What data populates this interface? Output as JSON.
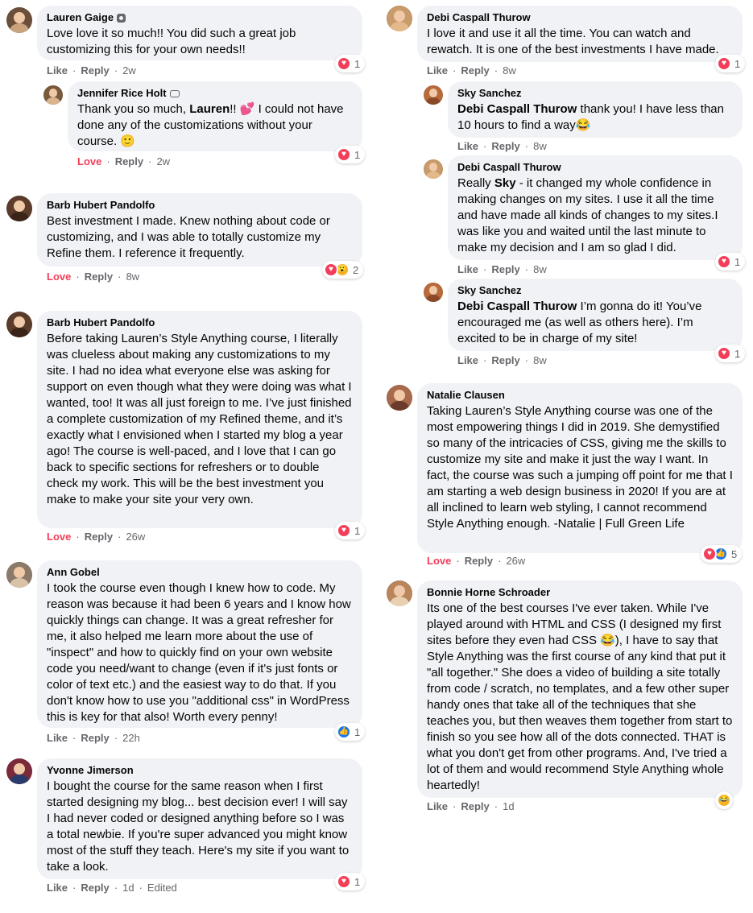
{
  "left_column": [
    {
      "name": "Lauren Gaige",
      "name_icon": "shield-icon",
      "text_parts": [
        {
          "t": "Love love it so much!! You did such a great job customizing this for your own needs!!"
        }
      ],
      "actions": {
        "first": "Like",
        "second": "Reply",
        "time": "2w"
      },
      "reactions": {
        "icons": [
          "love"
        ],
        "count": "1"
      },
      "avatar_colors": [
        "#c9a27e",
        "#6b4f3a"
      ]
    },
    {
      "name": "Jennifer Rice Holt",
      "name_icon": "chat-bubble-icon",
      "text_parts": [
        {
          "t": "Thank you so much, "
        },
        {
          "t": "Lauren",
          "bold": true
        },
        {
          "t": "!! 💕 I could not have done any of the customizations without your course. 🙂"
        }
      ],
      "actions": {
        "first": "Love",
        "second": "Reply",
        "time": "2w"
      },
      "reactions": {
        "icons": [
          "love"
        ],
        "count": "1"
      },
      "avatar_colors": [
        "#d9b48f",
        "#7a5a3c"
      ]
    },
    {
      "name": "Barb Hubert Pandolfo",
      "text_parts": [
        {
          "t": "Best investment I made. Knew nothing about code or customizing, and I was able to totally customize my Refine them. I reference it frequently."
        }
      ],
      "actions": {
        "first": "Love",
        "second": "Reply",
        "time": "8w"
      },
      "reactions": {
        "icons": [
          "love",
          "wow"
        ],
        "count": "2"
      },
      "avatar_colors": [
        "#3a2418",
        "#5b3b2a"
      ]
    },
    {
      "name": "Barb Hubert Pandolfo",
      "text_parts": [
        {
          "t": "Before taking Lauren’s Style Anything course, I literally was clueless about making any customizations to my site. I had no idea what everyone else was asking for support on even though what they were doing was what I wanted, too! It was all just foreign to me. I’ve just finished a complete customization of my Refined theme, and it’s exactly what I envisioned when I started my blog a year ago! The course is well-paced, and I love that I can go back to specific sections for refreshers or to double check my work. This will be the best investment you make to make your site your very own."
        }
      ],
      "actions": {
        "first": "Love",
        "second": "Reply",
        "time": "26w"
      },
      "reactions": {
        "icons": [
          "love"
        ],
        "count": "1"
      },
      "avatar_colors": [
        "#3a2418",
        "#5b3b2a"
      ]
    },
    {
      "name": "Ann Gobel",
      "text_parts": [
        {
          "t": "I took the course even though I knew how to code. My reason was because it had been 6 years and I know how quickly things can change. It was a great refresher for me, it also helped me learn more about the use of \"inspect\" and how to quickly find on your own website code you need/want to change (even if it's just fonts or color of text etc.) and the easiest way to do that. If you don't know how to use you \"additional css\" in WordPress this is key for that also! Worth every penny!"
        }
      ],
      "actions": {
        "first": "Like",
        "second": "Reply",
        "time": "22h"
      },
      "reactions": {
        "icons": [
          "like"
        ],
        "count": "1"
      },
      "avatar_colors": [
        "#d8c2a8",
        "#8b7a6a"
      ]
    },
    {
      "name": "Yvonne Jimerson",
      "text_parts": [
        {
          "t": "I bought the course for the same reason when I first started designing my blog... best decision ever! I will say I had never coded or designed anything before so I was a total newbie. If you're super advanced you might know most of the stuff they teach. Here's my site if you want to take a look."
        }
      ],
      "actions": {
        "first": "Like",
        "second": "Reply",
        "time": "1d",
        "extra": "Edited"
      },
      "reactions": {
        "icons": [
          "love"
        ],
        "count": "1"
      },
      "avatar_colors": [
        "#2a3a6a",
        "#7a2a3a"
      ]
    }
  ],
  "right_column": [
    {
      "name": "Debi Caspall Thurow",
      "text_parts": [
        {
          "t": "I love it and use it all the time. You can watch and rewatch. It is one of the best investments I have made."
        }
      ],
      "actions": {
        "first": "Like",
        "second": "Reply",
        "time": "8w"
      },
      "reactions": {
        "icons": [
          "love"
        ],
        "count": "1"
      },
      "avatar_colors": [
        "#e2b98a",
        "#c99a6a"
      ]
    },
    {
      "name": "Sky Sanchez",
      "text_parts": [
        {
          "t": "Debi Caspall Thurow",
          "bold": true
        },
        {
          "t": " thank you! I have less than 10 hours to find a way😂"
        }
      ],
      "actions": {
        "first": "Like",
        "second": "Reply",
        "time": "8w"
      },
      "avatar_colors": [
        "#8a4a2a",
        "#b86a3a"
      ]
    },
    {
      "name": "Debi Caspall Thurow",
      "text_parts": [
        {
          "t": "Really "
        },
        {
          "t": "Sky",
          "bold": true
        },
        {
          "t": " - it changed my whole confidence in making changes on my sites. I use it all the time and have made all kinds of changes to my sites.I was like you and waited until the last minute to make my decision and I am so glad I did."
        }
      ],
      "actions": {
        "first": "Like",
        "second": "Reply",
        "time": "8w"
      },
      "reactions": {
        "icons": [
          "love"
        ],
        "count": "1"
      },
      "avatar_colors": [
        "#e2b98a",
        "#c99a6a"
      ]
    },
    {
      "name": "Sky Sanchez",
      "text_parts": [
        {
          "t": "Debi Caspall Thurow",
          "bold": true
        },
        {
          "t": " I’m gonna do it! You’ve encouraged me (as well as others here). I’m excited to be in charge of my site!"
        }
      ],
      "actions": {
        "first": "Like",
        "second": "Reply",
        "time": "8w"
      },
      "reactions": {
        "icons": [
          "love"
        ],
        "count": "1"
      },
      "avatar_colors": [
        "#8a4a2a",
        "#b86a3a"
      ]
    },
    {
      "name": "Natalie Clausen",
      "text_parts": [
        {
          "t": "Taking Lauren’s Style Anything course was one of the most empowering things I did in 2019. She demystified so many of the intricacies of CSS, giving me the skills to customize my site and make it just the way I want. In fact, the course was such a jumping off point for me that I am starting a web design business in 2020! If you are at all inclined to learn web styling, I cannot recommend Style Anything enough. -Natalie | Full Green Life"
        }
      ],
      "actions": {
        "first": "Love",
        "second": "Reply",
        "time": "26w"
      },
      "reactions": {
        "icons": [
          "love",
          "like"
        ],
        "count": "5"
      },
      "avatar_colors": [
        "#6a3a2a",
        "#a86a4a"
      ]
    },
    {
      "name": "Bonnie Horne Schroader",
      "text_parts": [
        {
          "t": "Its one of the best courses I've ever taken. While I've played around with HTML and CSS (I designed my first sites before they even had CSS 😂), I have to say that Style Anything was the first course of any kind that put it \"all together.\" She does a video of building a site totally from code / scratch, no templates, and a few other super handy ones that take all of the techniques that she teaches you, but then weaves them together from start to finish so you see how all of the dots connected. THAT is what you don't get from other programs. And, I've tried a lot of them and would recommend Style Anything whole heartedly!"
        }
      ],
      "actions": {
        "first": "Like",
        "second": "Reply",
        "time": "1d"
      },
      "reactions": {
        "icons": [
          "haha"
        ],
        "count": ""
      },
      "avatar_colors": [
        "#e8d0b0",
        "#b8865a"
      ]
    }
  ]
}
